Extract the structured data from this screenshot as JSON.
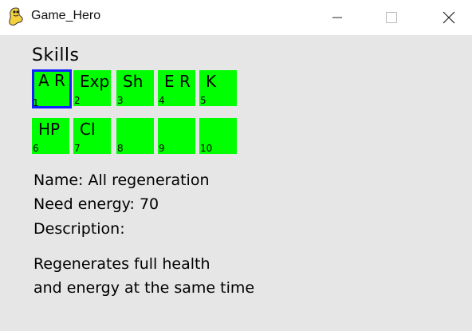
{
  "window": {
    "title": "Game_Hero",
    "icon": "pygame-snake-icon",
    "controls": [
      "minimize",
      "maximize",
      "close"
    ]
  },
  "skills": {
    "heading": "Skills",
    "selected_index": 0,
    "slot_color": "#00ff00",
    "selected_border_color": "#1020ff",
    "slots": [
      {
        "abbr": "A R",
        "num": "1"
      },
      {
        "abbr": "Exp",
        "num": "2"
      },
      {
        "abbr": "Sh",
        "num": "3"
      },
      {
        "abbr": "E R",
        "num": "4"
      },
      {
        "abbr": "K",
        "num": "5"
      },
      {
        "abbr": "HP",
        "num": "6"
      },
      {
        "abbr": "Cl",
        "num": "7"
      },
      {
        "abbr": "",
        "num": "8"
      },
      {
        "abbr": "",
        "num": "9"
      },
      {
        "abbr": "",
        "num": "10"
      }
    ]
  },
  "details": {
    "name_line": "Name: All regeneration",
    "energy_line": "Need energy: 70",
    "description_label": "Description:",
    "description_line1": "Regenerates full health",
    "description_line2": "and energy at the same time"
  }
}
